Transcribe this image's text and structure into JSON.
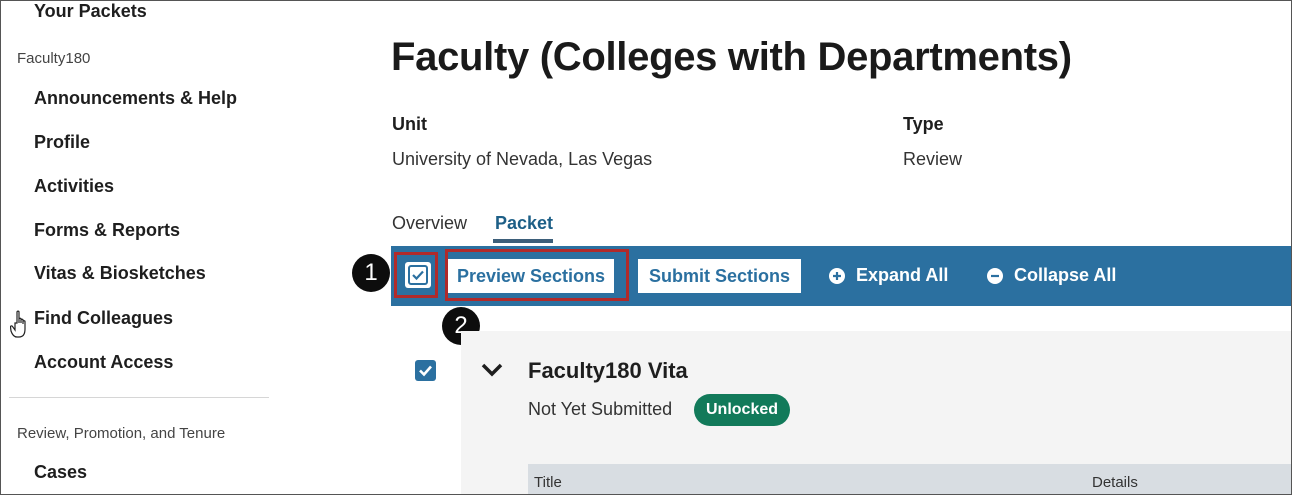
{
  "sidebar": {
    "top_item": "Your Packets",
    "group1": "Faculty180",
    "items": [
      {
        "label": "Announcements & Help"
      },
      {
        "label": "Profile"
      },
      {
        "label": "Activities"
      },
      {
        "label": "Forms & Reports"
      },
      {
        "label": "Vitas & Biosketches"
      },
      {
        "label": "Find Colleagues"
      },
      {
        "label": "Account Access"
      }
    ],
    "group2": "Review, Promotion, and Tenure",
    "group2_items": [
      {
        "label": "Cases"
      }
    ]
  },
  "page": {
    "title": "Faculty (Colleges with Departments)",
    "unit_label": "Unit",
    "unit_value": "University of Nevada, Las Vegas",
    "type_label": "Type",
    "type_value": "Review"
  },
  "tabs": [
    {
      "label": "Overview"
    },
    {
      "label": "Packet",
      "active": true
    }
  ],
  "toolbar": {
    "select_all_checked": true,
    "preview_label": "Preview Sections",
    "submit_label": "Submit Sections",
    "expand_label": "Expand All",
    "collapse_label": "Collapse All",
    "bg_color": "#2b70a0"
  },
  "annotations": {
    "step1": "1",
    "step2": "2"
  },
  "section": {
    "title": "Faculty180 Vita",
    "status": "Not Yet Submitted",
    "badge": "Unlocked",
    "badge_color": "#127a5a",
    "checked": true,
    "table_headers": [
      "Title",
      "Details"
    ]
  }
}
